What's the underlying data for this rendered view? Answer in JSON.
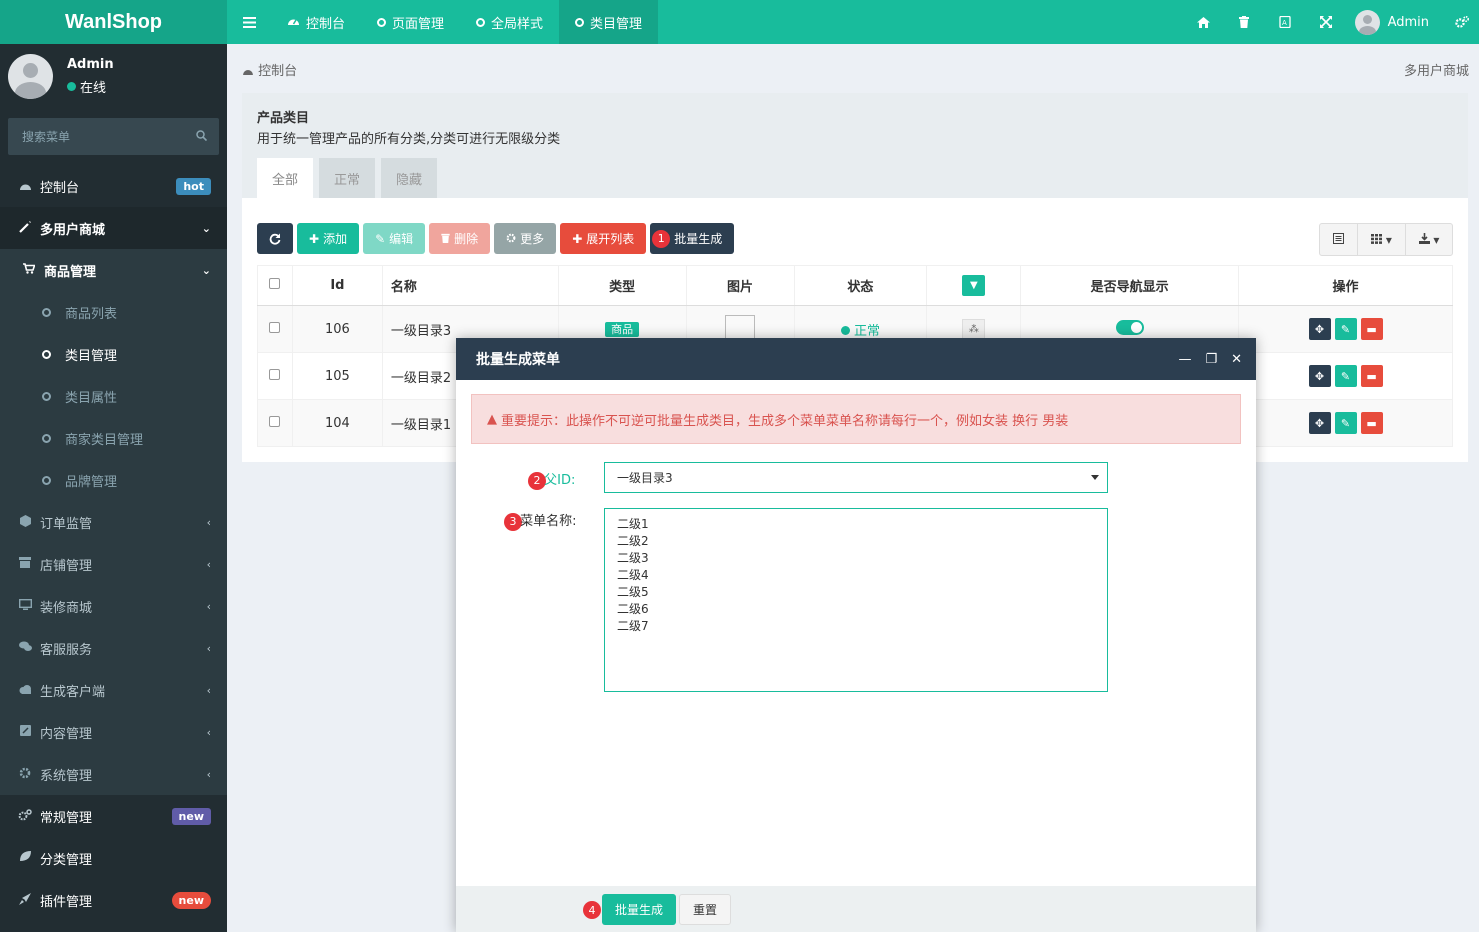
{
  "app": {
    "logo": "WanlShop",
    "colors": {
      "primary": "#18bc9c",
      "dark": "#2c3e50",
      "sidebar": "#222d32",
      "danger": "#e74c3c"
    }
  },
  "topnav": {
    "tabs": [
      {
        "label": "控制台",
        "icon": "dashboard-icon"
      },
      {
        "label": "页面管理",
        "icon": "circle-icon"
      },
      {
        "label": "全局样式",
        "icon": "circle-icon"
      },
      {
        "label": "类目管理",
        "icon": "circle-icon",
        "active": true
      }
    ],
    "user": "Admin"
  },
  "sidebar": {
    "user_name": "Admin",
    "user_status": "在线",
    "search_placeholder": "搜索菜单",
    "items": [
      {
        "label": "控制台",
        "icon": "dashboard-icon",
        "badge": "hot"
      },
      {
        "label": "多用户商城",
        "icon": "magic-icon"
      },
      {
        "label": "商品管理",
        "icon": "cart-icon"
      },
      {
        "label": "商品列表"
      },
      {
        "label": "类目管理"
      },
      {
        "label": "类目属性"
      },
      {
        "label": "商家类目管理"
      },
      {
        "label": "品牌管理"
      },
      {
        "label": "订单监管",
        "icon": "cube-icon"
      },
      {
        "label": "店铺管理",
        "icon": "store-icon"
      },
      {
        "label": "装修商城",
        "icon": "desktop-icon"
      },
      {
        "label": "客服服务",
        "icon": "comments-icon"
      },
      {
        "label": "生成客户端",
        "icon": "cloud-icon"
      },
      {
        "label": "内容管理",
        "icon": "edit-icon"
      },
      {
        "label": "系统管理",
        "icon": "gear-icon"
      },
      {
        "label": "常规管理",
        "icon": "cogs-icon",
        "badge": "new"
      },
      {
        "label": "分类管理",
        "icon": "leaf-icon"
      },
      {
        "label": "插件管理",
        "icon": "rocket-icon",
        "badge": "new"
      }
    ]
  },
  "breadcrumb": {
    "current": "控制台",
    "right": "多用户商城"
  },
  "panel": {
    "title": "产品类目",
    "description": "用于统一管理产品的所有分类,分类可进行无限级分类",
    "tabs": [
      "全部",
      "正常",
      "隐藏"
    ]
  },
  "toolbar": {
    "add": "添加",
    "edit": "编辑",
    "delete": "删除",
    "more": "更多",
    "expand": "展开列表",
    "batch": "批量生成",
    "batch_step": "1"
  },
  "table": {
    "headers": [
      "Id",
      "名称",
      "类型",
      "图片",
      "状态",
      "",
      "是否导航显示",
      "操作"
    ],
    "rows": [
      {
        "id": "106",
        "name": "一级目录3",
        "type": "商品",
        "status": "正常"
      },
      {
        "id": "105",
        "name": "一级目录2"
      },
      {
        "id": "104",
        "name": "一级目录1"
      }
    ]
  },
  "modal": {
    "title": "批量生成菜单",
    "alert": "重要提示：此操作不可逆可批量生成类目，生成多个菜单菜单名称请每行一个，例如女装 换行 男装",
    "parent_label": "父ID:",
    "parent_value": "一级目录3",
    "parent_step": "2",
    "names_label": "菜单名称:",
    "names_step": "3",
    "names_lines": [
      "二级1",
      "二级2",
      "二级3",
      "二级4",
      "二级5",
      "二级6",
      "二级7"
    ],
    "submit": "批量生成",
    "submit_step": "4",
    "reset": "重置"
  }
}
